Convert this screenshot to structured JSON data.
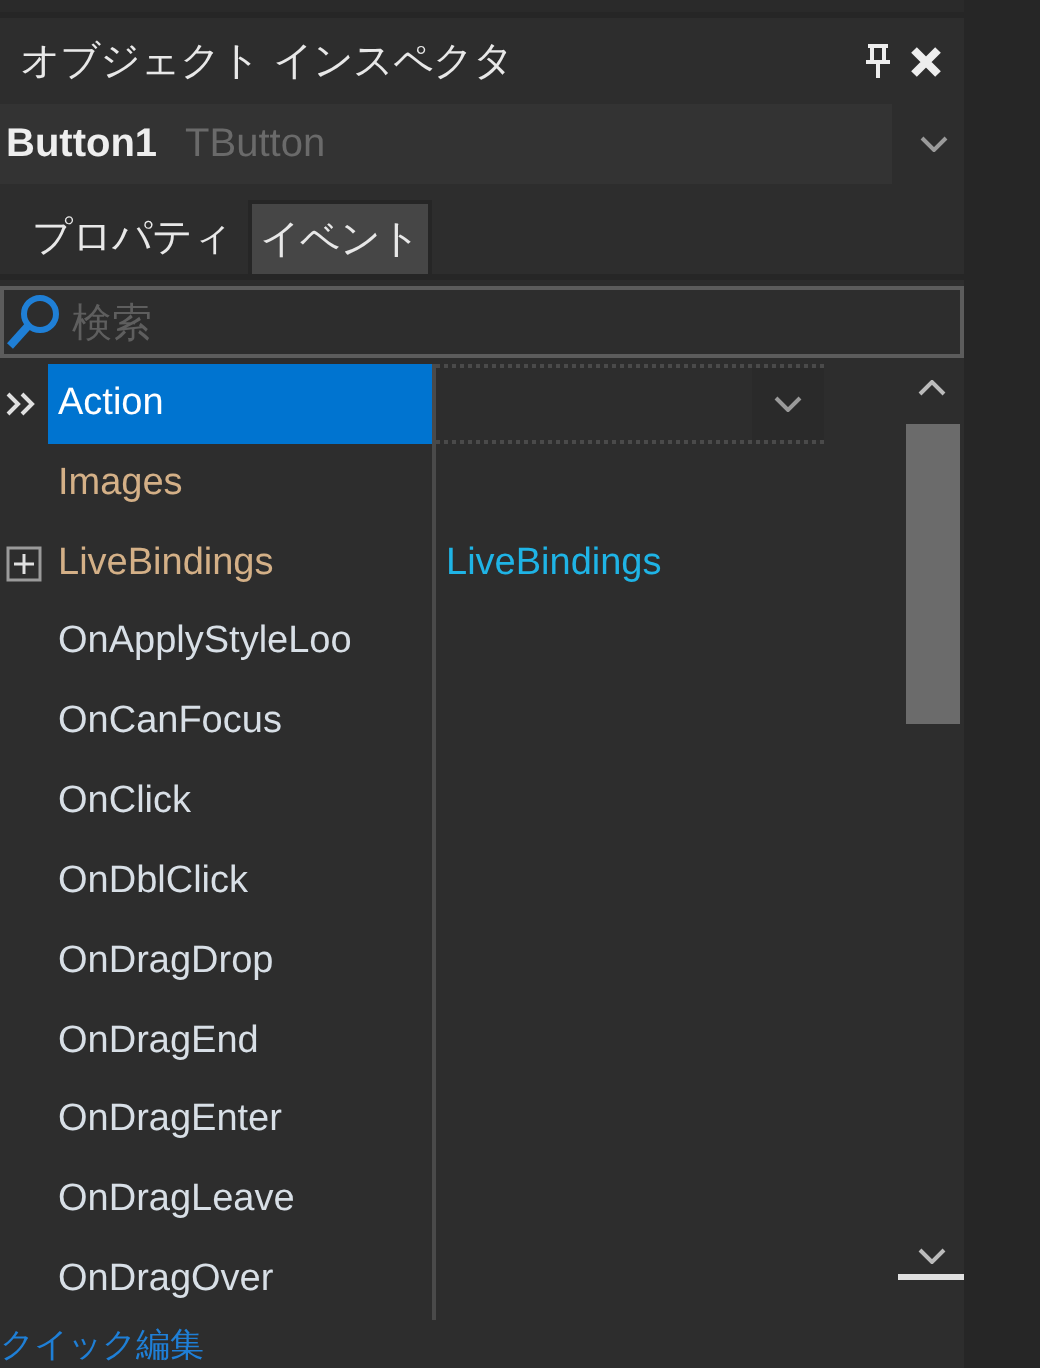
{
  "panel": {
    "title": "オブジェクト インスペクタ",
    "component": {
      "name": "Button1",
      "type": "TButton"
    },
    "tabs": [
      {
        "label": "プロパティ",
        "selected": false
      },
      {
        "label": "イベント",
        "selected": true
      }
    ],
    "search": {
      "placeholder": "検索"
    },
    "rows": [
      {
        "name": "Action",
        "kind": "reference",
        "selected": true
      },
      {
        "name": "Images",
        "kind": "reference",
        "selected": false
      },
      {
        "name": "LiveBindings",
        "kind": "reference",
        "selected": false,
        "expanded": false,
        "value": "LiveBindings"
      },
      {
        "name": "OnApplyStyleLoo",
        "kind": "event",
        "selected": false
      },
      {
        "name": "OnCanFocus",
        "kind": "event",
        "selected": false
      },
      {
        "name": "OnClick",
        "kind": "event",
        "selected": false
      },
      {
        "name": "OnDblClick",
        "kind": "event",
        "selected": false
      },
      {
        "name": "OnDragDrop",
        "kind": "event",
        "selected": false
      },
      {
        "name": "OnDragEnd",
        "kind": "event",
        "selected": false
      },
      {
        "name": "OnDragEnter",
        "kind": "event",
        "selected": false
      },
      {
        "name": "OnDragLeave",
        "kind": "event",
        "selected": false
      },
      {
        "name": "OnDragOver",
        "kind": "event",
        "selected": false
      }
    ],
    "footer_link": "クイック編集"
  }
}
